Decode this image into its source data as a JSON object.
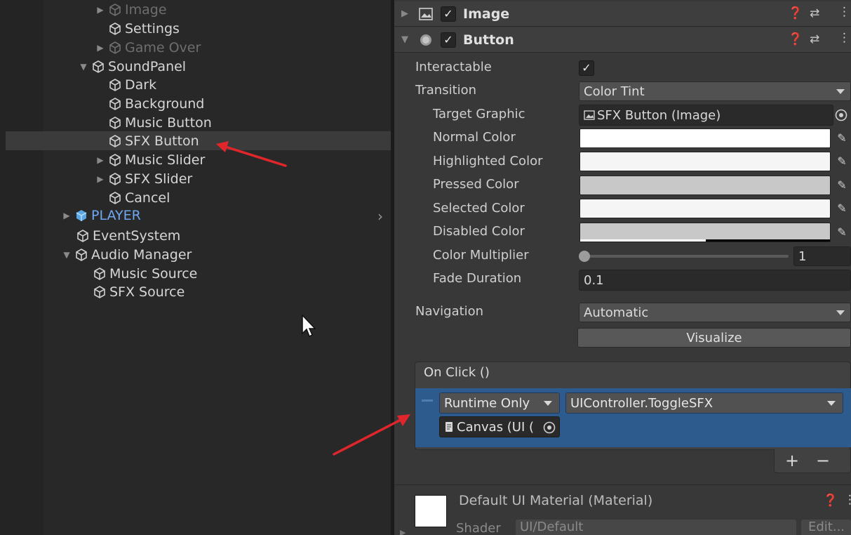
{
  "hierarchy": {
    "items": [
      {
        "label": "Image",
        "dim": true,
        "foldable": true
      },
      {
        "label": "Settings"
      },
      {
        "label": "Game Over",
        "dim": true,
        "foldable": true
      },
      {
        "label": "SoundPanel",
        "expanded": true
      },
      {
        "label": "Dark"
      },
      {
        "label": "Background"
      },
      {
        "label": "Music Button"
      },
      {
        "label": "SFX Button",
        "selected": true
      },
      {
        "label": "Music Slider",
        "foldable": true
      },
      {
        "label": "SFX Slider",
        "foldable": true
      },
      {
        "label": "Cancel"
      },
      {
        "label": "PLAYER",
        "prefab": true,
        "foldable": true
      },
      {
        "label": "EventSystem"
      },
      {
        "label": "Audio Manager",
        "expanded": true
      },
      {
        "label": "Music Source"
      },
      {
        "label": "SFX Source"
      }
    ]
  },
  "inspector": {
    "image_component": {
      "title": "Image",
      "enabled": true
    },
    "button_component": {
      "title": "Button",
      "enabled": true
    },
    "interactable": {
      "label": "Interactable",
      "checked": true
    },
    "transition": {
      "label": "Transition",
      "value": "Color Tint"
    },
    "target_graphic": {
      "label": "Target Graphic",
      "value": "SFX Button (Image)"
    },
    "colors": [
      {
        "label": "Normal Color",
        "hex": "#ffffff"
      },
      {
        "label": "Highlighted Color",
        "hex": "#f5f5f5"
      },
      {
        "label": "Pressed Color",
        "hex": "#c8c8c8"
      },
      {
        "label": "Selected Color",
        "hex": "#f5f5f5"
      },
      {
        "label": "Disabled Color",
        "hex": "#c8c8c8"
      }
    ],
    "color_multiplier": {
      "label": "Color Multiplier",
      "value": "1"
    },
    "fade_duration": {
      "label": "Fade Duration",
      "value": "0.1"
    },
    "navigation": {
      "label": "Navigation",
      "value": "Automatic"
    },
    "visualize_label": "Visualize",
    "on_click": {
      "title": "On Click ()",
      "runtime": "Runtime Only",
      "function": "UIController.ToggleSFX",
      "target": "Canvas (UI ("
    },
    "add_label": "+",
    "remove_label": "−",
    "material": {
      "title": "Default UI Material (Material)",
      "shader_label": "Shader",
      "shader_value": "UI/Default",
      "edit_label": "Edit..."
    }
  },
  "colors": {
    "annotation": "#e0262b",
    "selection": "#2d5b8e",
    "prefab": "#6fa7f2"
  }
}
